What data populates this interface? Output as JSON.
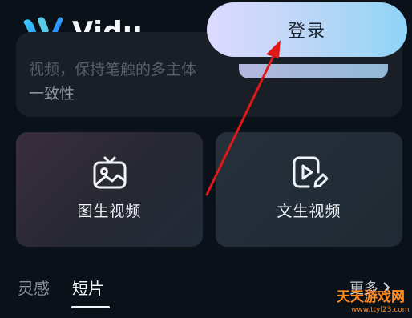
{
  "app": {
    "name": "Vidu"
  },
  "header": {
    "login_label": "登录"
  },
  "top_card": {
    "line1": "视频，保持笔触的多主体",
    "line2": "一致性"
  },
  "tiles": [
    {
      "label": "图生视频",
      "icon": "image-icon"
    },
    {
      "label": "文生视频",
      "icon": "video-edit-icon"
    }
  ],
  "tabs": [
    {
      "label": "灵感",
      "active": false
    },
    {
      "label": "短片",
      "active": true
    }
  ],
  "more_label": "更多",
  "watermark": {
    "text": "天天游戏网",
    "sub": "www.ttyl23.com"
  },
  "colors": {
    "login_gradient_start": "#ddd9ff",
    "login_gradient_end": "#8fd4f7",
    "annotation_arrow": "#e01818",
    "background": "#0b1118"
  }
}
